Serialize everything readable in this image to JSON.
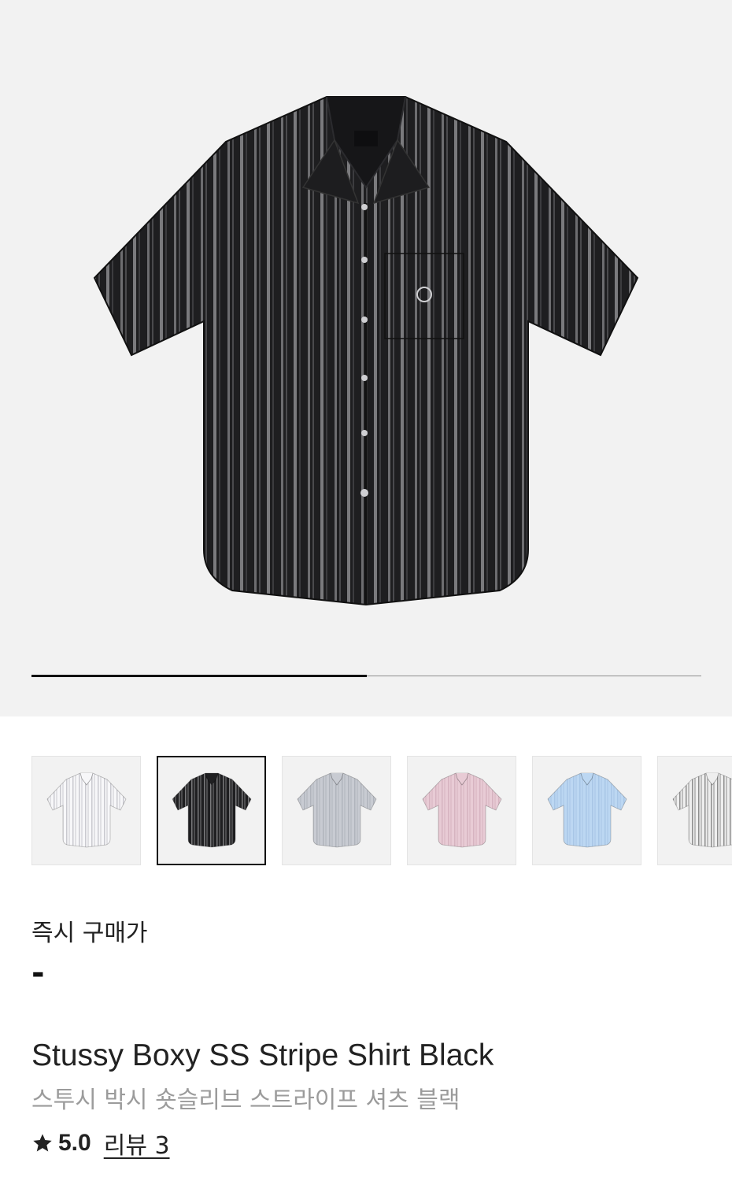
{
  "gallery": {
    "main_image": "black-stripe-shirt",
    "progress_fraction": 0.5,
    "thumbnails": [
      {
        "color": "white",
        "shirt": "#f7f7f9",
        "stripe": "#c9c9cf"
      },
      {
        "color": "black",
        "shirt": "#1f1f21",
        "stripe": "#7a7a7c",
        "selected": true
      },
      {
        "color": "grey",
        "shirt": "#c8cbd2",
        "stripe": "#b0b4bc"
      },
      {
        "color": "pink",
        "shirt": "#e8cbd5",
        "stripe": "#d6b3c0"
      },
      {
        "color": "blue",
        "shirt": "#bcd7f2",
        "stripe": "#a8c6e6"
      },
      {
        "color": "white-black",
        "shirt": "#eeeeee",
        "stripe": "#8d8d8d"
      }
    ]
  },
  "price": {
    "label": "즉시 구매가",
    "value": "-"
  },
  "product": {
    "title_en": "Stussy Boxy SS Stripe Shirt Black",
    "title_ko": "스투시 박시 숏슬리브 스트라이프 셔츠 블랙",
    "rating": "5.0",
    "reviews_label": "리뷰 3"
  },
  "icons": {
    "star": "star-icon"
  }
}
